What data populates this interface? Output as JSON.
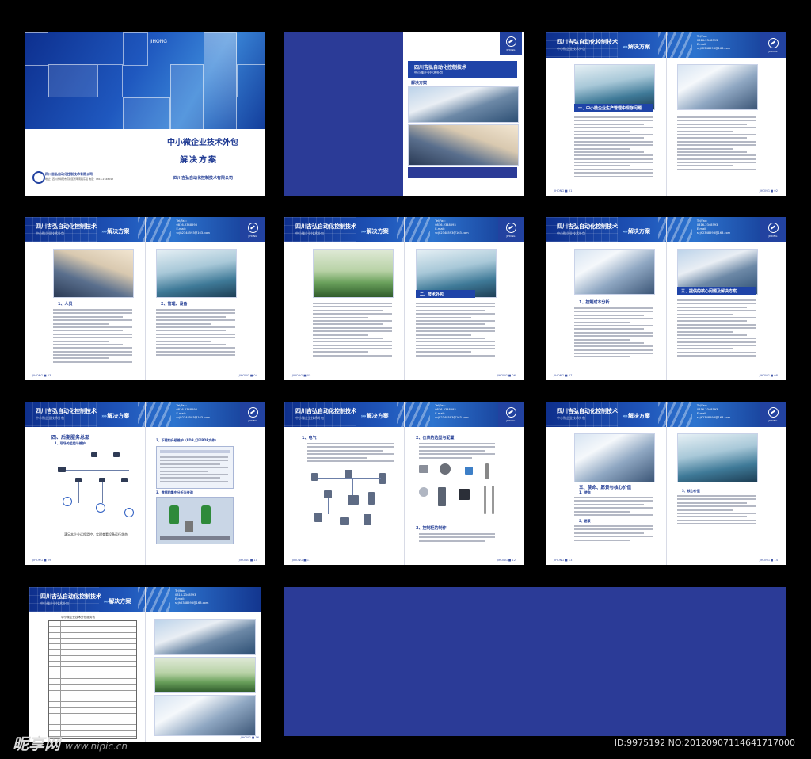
{
  "company_name": "四川吉弘自动化控制技术",
  "company_sub": "中小微企业技术外包",
  "solution_label": "解决方案",
  "logo_text": "JIHONG",
  "contact": {
    "tel_label": "Tel/Fax:",
    "tel": "0816-2348593",
    "email_label": "E-mail:",
    "email": "scjh2348593@163.com"
  },
  "cover": {
    "title_main": "中小微企业技术外包",
    "title_sub": "解决方案",
    "company_full": "四川吉弘自动化控制技术有限公司",
    "company_bottom": "四川吉弘自动化控制技术有限公司",
    "address_line": "地址：四川省绵阳市高新区普明南路东段 电话：0816-2348593"
  },
  "inner_cover": {
    "title": "四川吉弘自动化控制技术",
    "sub": "中小微企业技术外包",
    "sol": "解决方案"
  },
  "page_labels": [
    "JIHONG ■ 01",
    "JIHONG ■ 02",
    "JIHONG ■ 03",
    "JIHONG ■ 04",
    "JIHONG ■ 05",
    "JIHONG ■ 06",
    "JIHONG ■ 07",
    "JIHONG ■ 08",
    "JIHONG ■ 09",
    "JIHONG ■ 10",
    "JIHONG ■ 11",
    "JIHONG ■ 12",
    "JIHONG ■ 13",
    "JIHONG ■ 14",
    "JIHONG ■ 15",
    "JIHONG ■ 16"
  ],
  "sections": {
    "s1": "一、中小微企业生产管理中现存问题",
    "s2a": "1、人员",
    "s2b": "2、管理、设备",
    "s3": "二、技术外包",
    "s4": "三、提供的核心问题及解决方案",
    "s4a": "1、控制成本分析",
    "s5": "四、后期服务总部",
    "s5a": "1、现场的监控与维护",
    "s5b": "2、下载和升级维护（LDB,打印PDF文件）",
    "s5c": "3、数据的集中分析与查询",
    "s5note": "满足本企业远程监控，实时查看设备运行状态",
    "s6": "1、电气",
    "s6b": "2、仪表的选型与配置",
    "s6c": "3、控制柜的制作",
    "s7": "五、使命、愿景与核心价值",
    "s7a": "1、使命",
    "s7b": "2、愿景",
    "s7c": "3、核心价值",
    "s8": "中小微企业技术外包服务表"
  },
  "watermark": {
    "brand": "昵享网",
    "url": "www.nipic.cn",
    "id": "ID:9975192 NO:20120907114641717000"
  }
}
